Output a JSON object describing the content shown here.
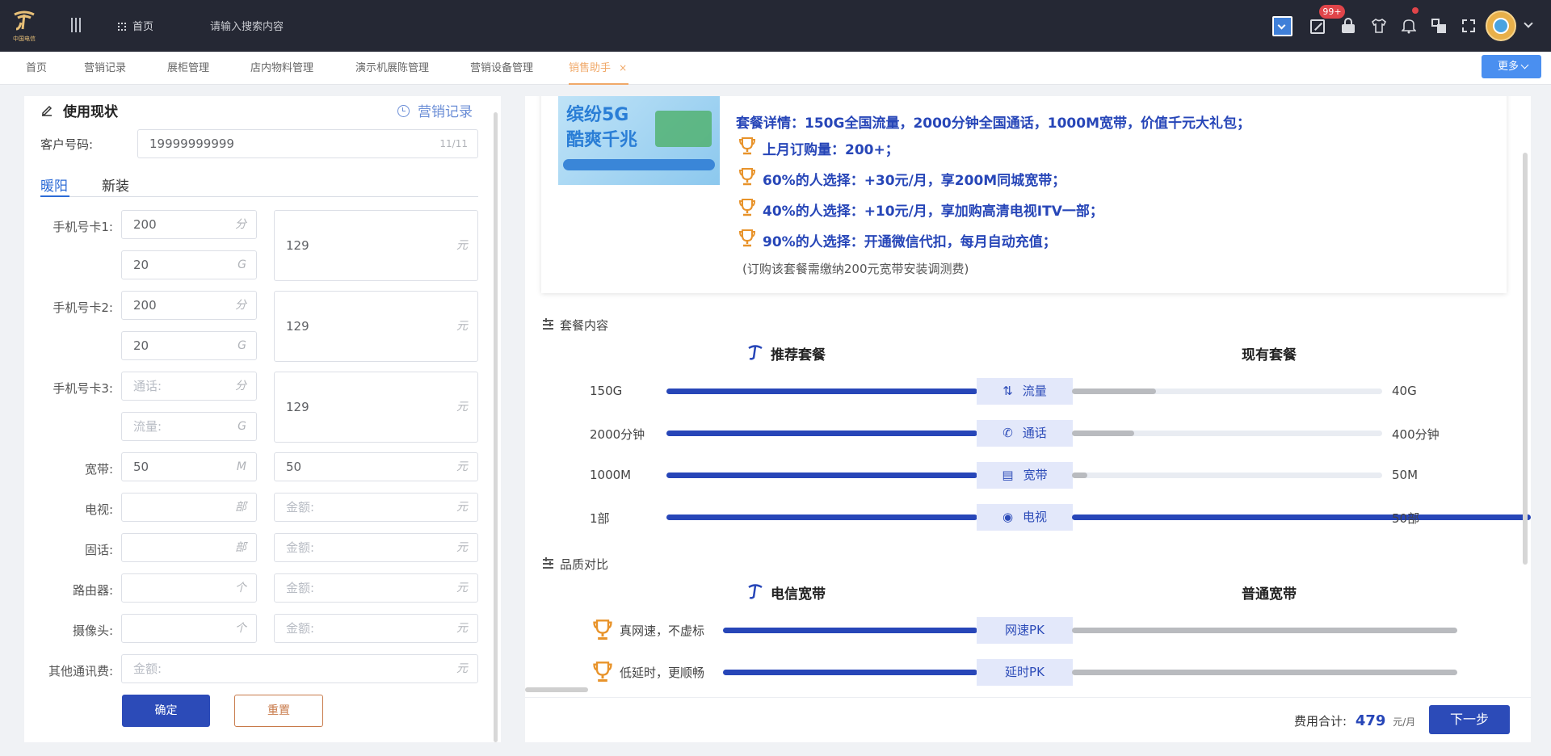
{
  "header": {
    "logo_text": "中国电信",
    "menu_icon": "menu-icon",
    "home_label": "首页",
    "search_placeholder": "请输入搜索内容",
    "notification_badge": "99+",
    "icons": [
      "dropdown-square-icon",
      "gift-icon",
      "lock-icon",
      "shirt-icon",
      "bell-icon",
      "translate-icon",
      "fullscreen-icon",
      "avatar",
      "chevron-down-icon"
    ]
  },
  "tabs": {
    "items": [
      {
        "label": "首页"
      },
      {
        "label": "营销记录"
      },
      {
        "label": "展柜管理"
      },
      {
        "label": "店内物料管理"
      },
      {
        "label": "演示机展陈管理"
      },
      {
        "label": "营销设备管理"
      },
      {
        "label": "销售助手",
        "active": true
      }
    ],
    "more_label": "更多",
    "accent_color": "#f0a868"
  },
  "left": {
    "title": "使用现状",
    "record_link": "营销记录",
    "customer_label": "客户号码:",
    "customer_value": "19999999999",
    "customer_count": "11/11",
    "subtabs": [
      "暖阳",
      "新装"
    ],
    "rows": {
      "card1": {
        "label": "手机号卡1:",
        "minutes": "200",
        "minutes_unit": "分",
        "data": "20",
        "data_unit": "G",
        "fee": "129",
        "fee_unit": "元"
      },
      "card2": {
        "label": "手机号卡2:",
        "minutes": "200",
        "minutes_unit": "分",
        "data": "20",
        "data_unit": "G",
        "fee": "129",
        "fee_unit": "元"
      },
      "card3": {
        "label": "手机号卡3:",
        "minutes_placeholder": "通话:",
        "minutes_unit": "分",
        "data_placeholder": "流量:",
        "data_unit": "G",
        "fee": "129",
        "fee_unit": "元"
      },
      "broadband": {
        "label": "宽带:",
        "value": "50",
        "unit": "M",
        "fee": "50",
        "fee_unit": "元"
      },
      "tv": {
        "label": "电视:",
        "unit": "部",
        "fee_placeholder": "金额:",
        "fee_unit": "元"
      },
      "landline": {
        "label": "固话:",
        "unit": "部",
        "fee_placeholder": "金额:",
        "fee_unit": "元"
      },
      "router": {
        "label": "路由器:",
        "unit": "个",
        "fee_placeholder": "金额:",
        "fee_unit": "元"
      },
      "camera": {
        "label": "摄像头:",
        "unit": "个",
        "fee_placeholder": "金额:",
        "fee_unit": "元"
      },
      "other": {
        "label": "其他通讯费:",
        "placeholder": "金额:",
        "unit": "元"
      }
    },
    "confirm_label": "确定",
    "reset_label": "重置"
  },
  "right": {
    "banner": {
      "title": "缤纷5G",
      "subtitle": "酷爽千兆"
    },
    "highlights": {
      "detail": "套餐详情：150G全国流量，2000分钟全国通话，1000M宽带，价值千元大礼包；",
      "bullets": [
        "上月订购量：200+；",
        "60%的人选择：+30元/月，享200M同城宽带；",
        "40%的人选择：+10元/月，享加购高清电视ITV一部；",
        "90%的人选择：开通微信代扣，每月自动充值；"
      ],
      "note": "(订购该套餐需缴纳200元宽带安装调测费)"
    },
    "package": {
      "section_title": "套餐内容",
      "recommended_label": "推荐套餐",
      "current_label": "现有套餐",
      "rows": [
        {
          "left": "150G",
          "category": "流量",
          "icon": "data-icon",
          "right": "40G",
          "current_fraction": 0.27
        },
        {
          "left": "2000分钟",
          "category": "通话",
          "icon": "phone-icon",
          "right": "400分钟",
          "current_fraction": 0.2
        },
        {
          "left": "1000M",
          "category": "宽带",
          "icon": "broadband-icon",
          "right": "50M",
          "current_fraction": 0.05
        },
        {
          "left": "1部",
          "category": "电视",
          "icon": "eye-icon",
          "right": "50部",
          "current_fraction": 1.0
        }
      ]
    },
    "quality": {
      "section_title": "品质对比",
      "ours_label": "电信宽带",
      "theirs_label": "普通宽带",
      "rows": [
        {
          "text": "真网速，不虚标",
          "category": "网速PK"
        },
        {
          "text": "低延时，更顺畅",
          "category": "延时PK"
        }
      ]
    },
    "footer": {
      "total_label": "费用合计:",
      "total_value": "479",
      "total_unit": "元/月",
      "next_label": "下一步"
    }
  },
  "colors": {
    "brand_blue": "#2746b8",
    "top_bg": "#252834",
    "trophy": "#e8932a",
    "primary_btn": "#4a8ff0"
  }
}
